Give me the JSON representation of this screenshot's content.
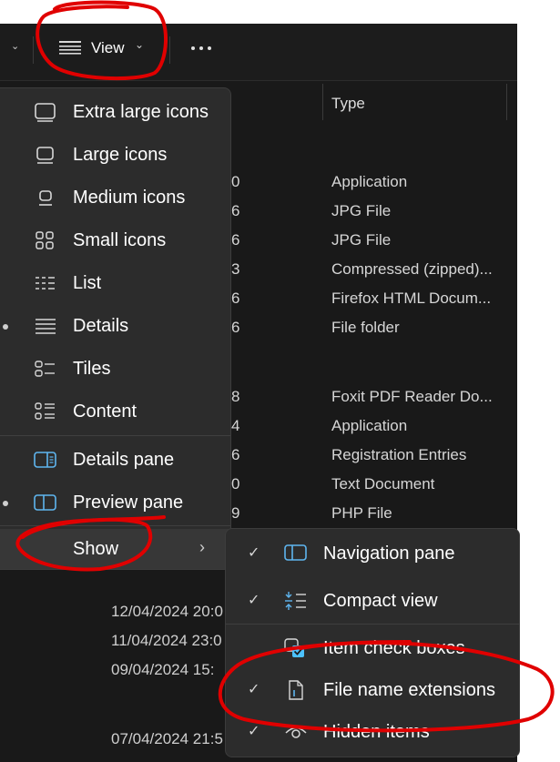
{
  "toolbar": {
    "view_label": "View",
    "more_label": "More options"
  },
  "file_list": {
    "column_type": "Type",
    "rows": [
      {
        "date_fragment": "0",
        "type": "Application"
      },
      {
        "date_fragment": "6",
        "type": "JPG File"
      },
      {
        "date_fragment": "6",
        "type": "JPG File"
      },
      {
        "date_fragment": "3",
        "type": "Compressed (zipped)..."
      },
      {
        "date_fragment": "6",
        "type": "Firefox HTML Docum..."
      },
      {
        "date_fragment": "6",
        "type": "File folder"
      },
      {
        "date_fragment": "8",
        "type": "Foxit PDF Reader Do..."
      },
      {
        "date_fragment": "4",
        "type": "Application"
      },
      {
        "date_fragment": "6",
        "type": "Registration Entries"
      },
      {
        "date_fragment": "0",
        "type": "Text Document"
      },
      {
        "date_fragment": "9",
        "type": "PHP File"
      }
    ],
    "lower_dates": [
      "12/04/2024 20:0",
      "11/04/2024 23:0",
      "09/04/2024 15:",
      "07/04/2024 21:5"
    ]
  },
  "view_menu": {
    "items": [
      {
        "label": "Extra large icons",
        "icon": "extra-large-icons-icon",
        "selected": false
      },
      {
        "label": "Large icons",
        "icon": "large-icons-icon",
        "selected": false
      },
      {
        "label": "Medium icons",
        "icon": "medium-icons-icon",
        "selected": false
      },
      {
        "label": "Small icons",
        "icon": "small-icons-icon",
        "selected": false
      },
      {
        "label": "List",
        "icon": "list-icon",
        "selected": false
      },
      {
        "label": "Details",
        "icon": "details-icon",
        "selected": true
      },
      {
        "label": "Tiles",
        "icon": "tiles-icon",
        "selected": false
      },
      {
        "label": "Content",
        "icon": "content-icon",
        "selected": false
      }
    ],
    "panes": [
      {
        "label": "Details pane",
        "icon": "details-pane-icon",
        "selected": false
      },
      {
        "label": "Preview pane",
        "icon": "preview-pane-icon",
        "selected": true
      }
    ],
    "show_label": "Show"
  },
  "show_menu": {
    "items": [
      {
        "label": "Navigation pane",
        "icon": "navigation-pane-icon",
        "checked": true
      },
      {
        "label": "Compact view",
        "icon": "compact-view-icon",
        "checked": true
      },
      {
        "label": "Item check boxes",
        "icon": "item-check-boxes-icon",
        "checked": false
      },
      {
        "label": "File name extensions",
        "icon": "file-name-extensions-icon",
        "checked": true
      },
      {
        "label": "Hidden items",
        "icon": "hidden-items-icon",
        "checked": true
      }
    ]
  },
  "colors": {
    "background": "#191919",
    "menu": "#2c2c2c",
    "accent": "#4cc2ff",
    "annotation": "#e00000"
  }
}
